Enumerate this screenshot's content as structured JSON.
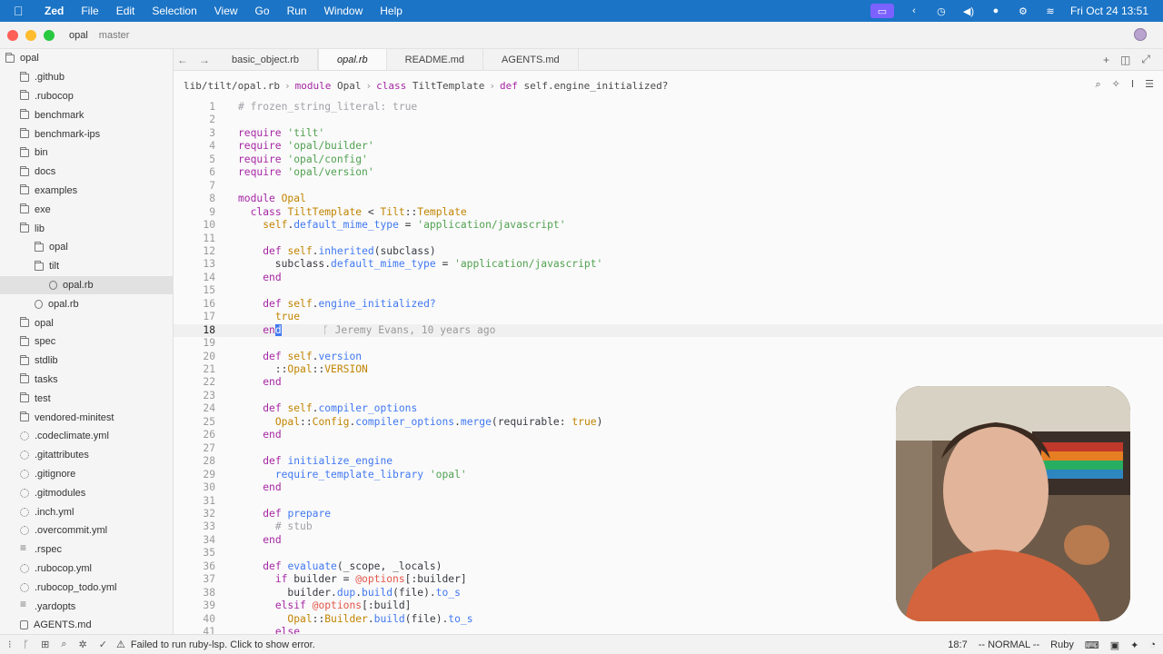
{
  "menubar": {
    "app_name": "Zed",
    "items": [
      "File",
      "Edit",
      "Selection",
      "View",
      "Go",
      "Run",
      "Window",
      "Help"
    ],
    "datetime": "Fri Oct 24  13:51"
  },
  "titlebar": {
    "project": "opal",
    "branch": "master"
  },
  "sidebar": {
    "items": [
      {
        "label": "opal",
        "icon": "folder-open-icon",
        "depth": 0
      },
      {
        "label": ".github",
        "icon": "folder-icon",
        "depth": 1
      },
      {
        "label": ".rubocop",
        "icon": "folder-icon",
        "depth": 1
      },
      {
        "label": "benchmark",
        "icon": "folder-icon",
        "depth": 1
      },
      {
        "label": "benchmark-ips",
        "icon": "folder-icon",
        "depth": 1
      },
      {
        "label": "bin",
        "icon": "folder-icon",
        "depth": 1
      },
      {
        "label": "docs",
        "icon": "folder-icon",
        "depth": 1
      },
      {
        "label": "examples",
        "icon": "folder-icon",
        "depth": 1
      },
      {
        "label": "exe",
        "icon": "folder-icon",
        "depth": 1
      },
      {
        "label": "lib",
        "icon": "folder-open-icon",
        "depth": 1
      },
      {
        "label": "opal",
        "icon": "folder-icon",
        "depth": 2
      },
      {
        "label": "tilt",
        "icon": "folder-open-icon",
        "depth": 2
      },
      {
        "label": "opal.rb",
        "icon": "ruby-file-icon",
        "depth": 3,
        "active": true
      },
      {
        "label": "opal.rb",
        "icon": "ruby-file-icon",
        "depth": 2
      },
      {
        "label": "opal",
        "icon": "folder-icon",
        "depth": 1
      },
      {
        "label": "spec",
        "icon": "folder-icon",
        "depth": 1
      },
      {
        "label": "stdlib",
        "icon": "folder-icon",
        "depth": 1
      },
      {
        "label": "tasks",
        "icon": "folder-icon",
        "depth": 1
      },
      {
        "label": "test",
        "icon": "folder-icon",
        "depth": 1
      },
      {
        "label": "vendored-minitest",
        "icon": "folder-icon",
        "depth": 1
      },
      {
        "label": ".codeclimate.yml",
        "icon": "gear-icon",
        "depth": 1
      },
      {
        "label": ".gitattributes",
        "icon": "git-icon",
        "depth": 1
      },
      {
        "label": ".gitignore",
        "icon": "git-icon",
        "depth": 1
      },
      {
        "label": ".gitmodules",
        "icon": "git-icon",
        "depth": 1
      },
      {
        "label": ".inch.yml",
        "icon": "gear-icon",
        "depth": 1
      },
      {
        "label": ".overcommit.yml",
        "icon": "gear-icon",
        "depth": 1
      },
      {
        "label": ".rspec",
        "icon": "lines-icon",
        "depth": 1
      },
      {
        "label": ".rubocop.yml",
        "icon": "gear-icon",
        "depth": 1
      },
      {
        "label": ".rubocop_todo.yml",
        "icon": "gear-icon",
        "depth": 1
      },
      {
        "label": ".yardopts",
        "icon": "lines-icon",
        "depth": 1
      },
      {
        "label": "AGENTS.md",
        "icon": "markdown-file-icon",
        "depth": 1
      }
    ]
  },
  "tabs": [
    {
      "label": "basic_object.rb",
      "active": false
    },
    {
      "label": "opal.rb",
      "active": true
    },
    {
      "label": "README.md",
      "active": false
    },
    {
      "label": "AGENTS.md",
      "active": false
    }
  ],
  "breadcrumb": {
    "path": "lib/tilt/opal.rb",
    "segments": [
      {
        "kw": "module",
        "name": "Opal"
      },
      {
        "kw": "class",
        "name": "TiltTemplate"
      },
      {
        "kw": "def",
        "name": "self.engine_initialized?"
      }
    ]
  },
  "editor": {
    "current_line": 18,
    "blame": "Jeremy Evans, 10 years ago",
    "lines": [
      {
        "n": "1",
        "tokens": [
          [
            "cm",
            "# frozen_string_literal: true"
          ]
        ]
      },
      {
        "n": "2",
        "tokens": []
      },
      {
        "n": "3",
        "tokens": [
          [
            "kw",
            "require"
          ],
          [
            "var",
            " "
          ],
          [
            "str",
            "'tilt'"
          ]
        ]
      },
      {
        "n": "4",
        "tokens": [
          [
            "kw",
            "require"
          ],
          [
            "var",
            " "
          ],
          [
            "str",
            "'opal/builder'"
          ]
        ]
      },
      {
        "n": "5",
        "tokens": [
          [
            "kw",
            "require"
          ],
          [
            "var",
            " "
          ],
          [
            "str",
            "'opal/config'"
          ]
        ]
      },
      {
        "n": "6",
        "tokens": [
          [
            "kw",
            "require"
          ],
          [
            "var",
            " "
          ],
          [
            "str",
            "'opal/version'"
          ]
        ]
      },
      {
        "n": "7",
        "tokens": []
      },
      {
        "n": "8",
        "tokens": [
          [
            "kw",
            "module"
          ],
          [
            "var",
            " "
          ],
          [
            "const",
            "Opal"
          ]
        ]
      },
      {
        "n": "9",
        "tokens": [
          [
            "var",
            "  "
          ],
          [
            "kw",
            "class"
          ],
          [
            "var",
            " "
          ],
          [
            "const",
            "TiltTemplate"
          ],
          [
            "var",
            " < "
          ],
          [
            "const",
            "Tilt"
          ],
          [
            "var",
            "::"
          ],
          [
            "const",
            "Template"
          ]
        ]
      },
      {
        "n": "10",
        "tokens": [
          [
            "var",
            "    "
          ],
          [
            "const",
            "self"
          ],
          [
            "var",
            "."
          ],
          [
            "fn",
            "default_mime_type"
          ],
          [
            "var",
            " = "
          ],
          [
            "str",
            "'application/javascript'"
          ]
        ]
      },
      {
        "n": "11",
        "tokens": []
      },
      {
        "n": "12",
        "tokens": [
          [
            "var",
            "    "
          ],
          [
            "kw",
            "def"
          ],
          [
            "var",
            " "
          ],
          [
            "const",
            "self"
          ],
          [
            "var",
            "."
          ],
          [
            "fn",
            "inherited"
          ],
          [
            "var",
            "(subclass)"
          ]
        ]
      },
      {
        "n": "13",
        "tokens": [
          [
            "var",
            "      subclass."
          ],
          [
            "fn",
            "default_mime_type"
          ],
          [
            "var",
            " = "
          ],
          [
            "str",
            "'application/javascript'"
          ]
        ]
      },
      {
        "n": "14",
        "tokens": [
          [
            "var",
            "    "
          ],
          [
            "kw",
            "end"
          ]
        ]
      },
      {
        "n": "15",
        "tokens": []
      },
      {
        "n": "16",
        "tokens": [
          [
            "var",
            "    "
          ],
          [
            "kw",
            "def"
          ],
          [
            "var",
            " "
          ],
          [
            "const",
            "self"
          ],
          [
            "var",
            "."
          ],
          [
            "fn",
            "engine_initialized?"
          ]
        ]
      },
      {
        "n": "17",
        "tokens": [
          [
            "var",
            "      "
          ],
          [
            "const",
            "true"
          ]
        ]
      },
      {
        "n": "18",
        "tokens": [
          [
            "var",
            "    "
          ],
          [
            "kw",
            "en"
          ],
          [
            "cursor",
            "d"
          ]
        ]
      },
      {
        "n": "19",
        "tokens": []
      },
      {
        "n": "20",
        "tokens": [
          [
            "var",
            "    "
          ],
          [
            "kw",
            "def"
          ],
          [
            "var",
            " "
          ],
          [
            "const",
            "self"
          ],
          [
            "var",
            "."
          ],
          [
            "fn",
            "version"
          ]
        ]
      },
      {
        "n": "21",
        "tokens": [
          [
            "var",
            "      ::"
          ],
          [
            "const",
            "Opal"
          ],
          [
            "var",
            "::"
          ],
          [
            "const",
            "VERSION"
          ]
        ]
      },
      {
        "n": "22",
        "tokens": [
          [
            "var",
            "    "
          ],
          [
            "kw",
            "end"
          ]
        ]
      },
      {
        "n": "23",
        "tokens": []
      },
      {
        "n": "24",
        "tokens": [
          [
            "var",
            "    "
          ],
          [
            "kw",
            "def"
          ],
          [
            "var",
            " "
          ],
          [
            "const",
            "self"
          ],
          [
            "var",
            "."
          ],
          [
            "fn",
            "compiler_options"
          ]
        ]
      },
      {
        "n": "25",
        "tokens": [
          [
            "var",
            "      "
          ],
          [
            "const",
            "Opal"
          ],
          [
            "var",
            "::"
          ],
          [
            "const",
            "Config"
          ],
          [
            "var",
            "."
          ],
          [
            "fn",
            "compiler_options"
          ],
          [
            "var",
            "."
          ],
          [
            "fn",
            "merge"
          ],
          [
            "var",
            "(requirable: "
          ],
          [
            "const",
            "true"
          ],
          [
            "var",
            ")"
          ]
        ]
      },
      {
        "n": "26",
        "tokens": [
          [
            "var",
            "    "
          ],
          [
            "kw",
            "end"
          ]
        ]
      },
      {
        "n": "27",
        "tokens": []
      },
      {
        "n": "28",
        "tokens": [
          [
            "var",
            "    "
          ],
          [
            "kw",
            "def"
          ],
          [
            "var",
            " "
          ],
          [
            "fn",
            "initialize_engine"
          ]
        ]
      },
      {
        "n": "29",
        "tokens": [
          [
            "var",
            "      "
          ],
          [
            "fn",
            "require_template_library"
          ],
          [
            "var",
            " "
          ],
          [
            "str",
            "'opal'"
          ]
        ]
      },
      {
        "n": "30",
        "tokens": [
          [
            "var",
            "    "
          ],
          [
            "kw",
            "end"
          ]
        ]
      },
      {
        "n": "31",
        "tokens": []
      },
      {
        "n": "32",
        "tokens": [
          [
            "var",
            "    "
          ],
          [
            "kw",
            "def"
          ],
          [
            "var",
            " "
          ],
          [
            "fn",
            "prepare"
          ]
        ]
      },
      {
        "n": "33",
        "tokens": [
          [
            "var",
            "      "
          ],
          [
            "cm",
            "# stub"
          ]
        ]
      },
      {
        "n": "34",
        "tokens": [
          [
            "var",
            "    "
          ],
          [
            "kw",
            "end"
          ]
        ]
      },
      {
        "n": "35",
        "tokens": []
      },
      {
        "n": "36",
        "tokens": [
          [
            "var",
            "    "
          ],
          [
            "kw",
            "def"
          ],
          [
            "var",
            " "
          ],
          [
            "fn",
            "evaluate"
          ],
          [
            "var",
            "(_scope, _locals)"
          ]
        ]
      },
      {
        "n": "37",
        "tokens": [
          [
            "var",
            "      "
          ],
          [
            "kw",
            "if"
          ],
          [
            "var",
            " builder = "
          ],
          [
            "ivar",
            "@options"
          ],
          [
            "var",
            "[:builder]"
          ]
        ]
      },
      {
        "n": "38",
        "tokens": [
          [
            "var",
            "        builder."
          ],
          [
            "fn",
            "dup"
          ],
          [
            "var",
            "."
          ],
          [
            "fn",
            "build"
          ],
          [
            "var",
            "(file)."
          ],
          [
            "fn",
            "to_s"
          ]
        ]
      },
      {
        "n": "39",
        "tokens": [
          [
            "var",
            "      "
          ],
          [
            "kw",
            "elsif"
          ],
          [
            "var",
            " "
          ],
          [
            "ivar",
            "@options"
          ],
          [
            "var",
            "[:build]"
          ]
        ]
      },
      {
        "n": "40",
        "tokens": [
          [
            "var",
            "        "
          ],
          [
            "const",
            "Opal"
          ],
          [
            "var",
            "::"
          ],
          [
            "const",
            "Builder"
          ],
          [
            "var",
            "."
          ],
          [
            "fn",
            "build"
          ],
          [
            "var",
            "(file)."
          ],
          [
            "fn",
            "to_s"
          ]
        ]
      },
      {
        "n": "41",
        "tokens": [
          [
            "var",
            "      "
          ],
          [
            "kw",
            "else"
          ]
        ]
      }
    ]
  },
  "statusbar": {
    "message": "Failed to run ruby-lsp. Click to show error.",
    "position": "18:7",
    "mode": "-- NORMAL --",
    "language": "Ruby"
  }
}
